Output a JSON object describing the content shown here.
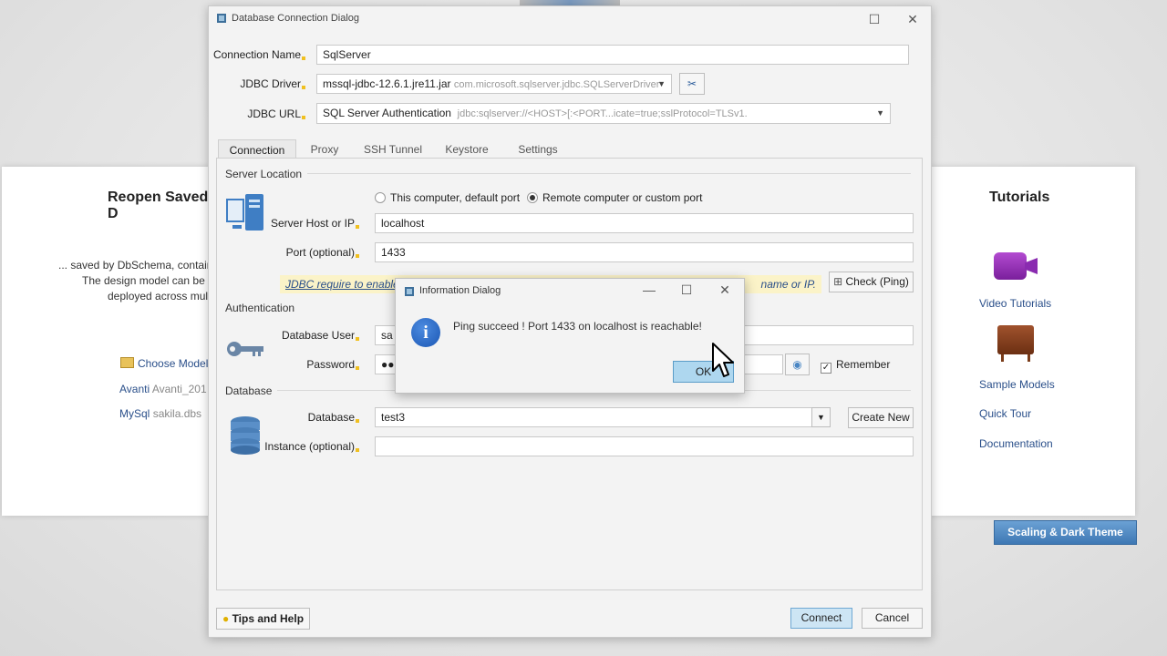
{
  "background": {
    "left_panel": {
      "title": "Reopen Saved D",
      "desc_line1": "... saved by DbSchema, contain",
      "desc_line2": "The design model can be",
      "desc_line3": "deployed across mul",
      "choose_model": "Choose Model",
      "recent": [
        {
          "name": "Avanti",
          "file": "Avanti_201"
        },
        {
          "name": "MySql",
          "file": "sakila.dbs"
        }
      ]
    },
    "right_panel": {
      "title": "Tutorials",
      "video_tutorials": "Video Tutorials",
      "sample_models": "Sample Models",
      "quick_tour": "Quick Tour",
      "documentation": "Documentation"
    },
    "scaling_button": "Scaling & Dark Theme"
  },
  "dialog": {
    "title": "Database Connection Dialog",
    "connection_name_label": "Connection Name",
    "connection_name_value": "SqlServer",
    "jdbc_driver_label": "JDBC Driver",
    "jdbc_driver_value": "mssql-jdbc-12.6.1.jre11.jar",
    "jdbc_driver_class": "com.microsoft.sqlserver.jdbc.SQLServerDriver",
    "jdbc_url_label": "JDBC URL",
    "jdbc_url_auth": "SQL Server Authentication",
    "jdbc_url_value": "jdbc:sqlserver://<HOST>[:<PORT...icate=true;sslProtocol=TLSv1.",
    "tabs": [
      "Connection",
      "Proxy",
      "SSH Tunnel",
      "Keystore",
      "Settings"
    ],
    "server_location": {
      "section": "Server Location",
      "radio_local": "This computer, default port",
      "radio_remote": "Remote computer or custom port",
      "host_label": "Server Host or IP",
      "host_value": "localhost",
      "port_label": "Port (optional)",
      "port_value": "1433",
      "warning": "JDBC require to enable T",
      "warning_tail": "name or IP.",
      "check_button": "Check (Ping)"
    },
    "authentication": {
      "section": "Authentication",
      "user_label": "Database User",
      "user_value": "sa",
      "password_label": "Password",
      "password_value": "●●",
      "remember_label": "Remember"
    },
    "database": {
      "section": "Database",
      "database_label": "Database",
      "database_value": "test3",
      "create_new": "Create New",
      "instance_label": "Instance (optional)",
      "instance_value": ""
    },
    "tips_button": "Tips and Help",
    "connect_button": "Connect",
    "cancel_button": "Cancel"
  },
  "info_dialog": {
    "title": "Information Dialog",
    "message": "Ping succeed ! Port 1433 on localhost is reachable!",
    "ok": "OK"
  }
}
